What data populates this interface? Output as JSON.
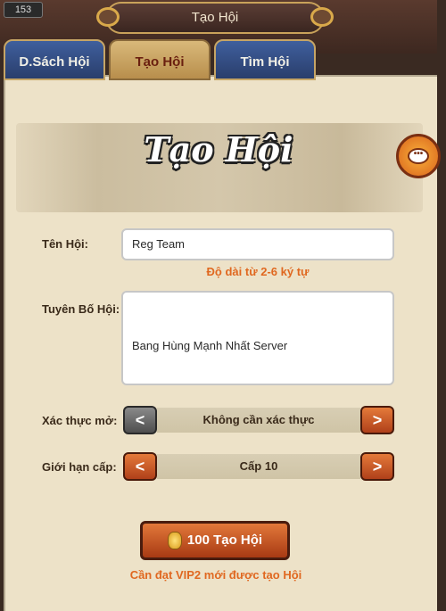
{
  "header": {
    "level": "153",
    "title": "Tạo Hội"
  },
  "tabs": [
    {
      "label": "D.Sách Hội"
    },
    {
      "label": "Tạo Hội"
    },
    {
      "label": "Tìm Hội"
    }
  ],
  "banner": {
    "title": "Tạo Hội"
  },
  "form": {
    "name_label": "Tên Hội:",
    "name_value": "Reg Team",
    "name_hint": "Độ dài từ 2-6 ký tự",
    "declaration_label": "Tuyên Bố Hội:",
    "declaration_value": "Bang Hùng Mạnh Nhất Server",
    "verify_label": "Xác thực mở:",
    "verify_value": "Không cần xác thực",
    "level_label": "Giới hạn cấp:",
    "level_value": "Cấp 10",
    "prev_symbol": "<",
    "next_symbol": ">"
  },
  "create_button": {
    "label": "100 Tạo Hội",
    "requirement": "Cần đạt VIP2 mới được tạo Hội"
  },
  "icons": {
    "chat": "chat-bubble-icon",
    "coin": "gold-coin-icon"
  }
}
